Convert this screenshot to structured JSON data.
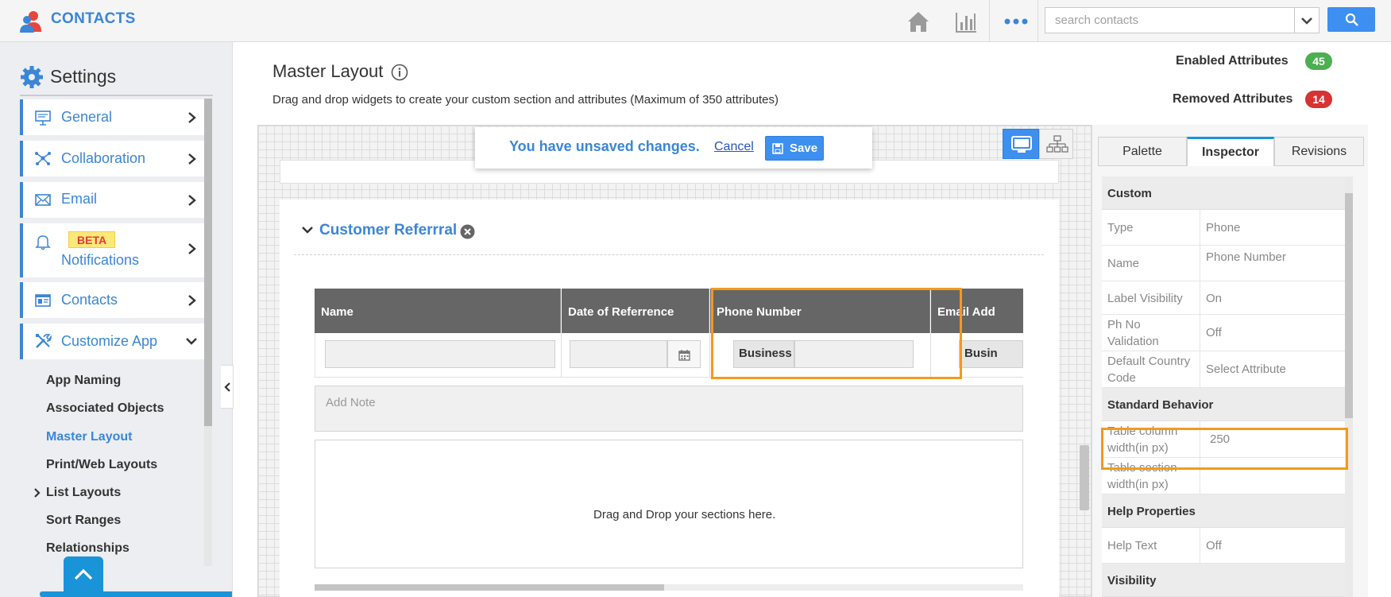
{
  "app": {
    "title": "CONTACTS"
  },
  "topbar": {
    "icons": [
      "home-icon",
      "analytics-icon",
      "more-icon"
    ],
    "search": {
      "placeholder": "search contacts",
      "value": ""
    }
  },
  "sidebar": {
    "title": "Settings",
    "items": [
      {
        "label": "General",
        "icon": "monitor-icon"
      },
      {
        "label": "Collaboration",
        "icon": "collaboration-icon"
      },
      {
        "label": "Email",
        "icon": "envelope-icon"
      },
      {
        "label": "Notifications",
        "icon": "bell-icon",
        "badge": "BETA"
      },
      {
        "label": "Contacts",
        "icon": "contact-card-icon"
      },
      {
        "label": "Customize App",
        "icon": "tools-icon",
        "expanded": true
      }
    ],
    "sub_items": [
      {
        "label": "App Naming"
      },
      {
        "label": "Associated Objects"
      },
      {
        "label": "Master Layout",
        "active": true
      },
      {
        "label": "Print/Web Layouts"
      },
      {
        "label": "List Layouts",
        "has_children": true
      },
      {
        "label": "Sort Ranges"
      },
      {
        "label": "Relationships"
      }
    ]
  },
  "main": {
    "title": "Master Layout",
    "description": "Drag and drop widgets to create your custom section and attributes (Maximum of 350 attributes)",
    "stats": {
      "enabled_label": "Enabled Attributes",
      "enabled_count": "45",
      "removed_label": "Removed Attributes",
      "removed_count": "14"
    },
    "unsaved": {
      "message": "You have unsaved changes.",
      "cancel_label": "Cancel",
      "save_label": "Save"
    },
    "section": {
      "title": "Customer Referrral",
      "columns": [
        "Name",
        "Date of Referrence",
        "Phone Number",
        "Email Add"
      ],
      "phone_prefix": "Business",
      "email_prefix": "Busin",
      "note_placeholder": "Add Note",
      "drop_text": "Drag and Drop your sections here."
    }
  },
  "inspector": {
    "tabs": [
      "Palette",
      "Inspector",
      "Revisions"
    ],
    "active_tab": "Inspector",
    "groups": {
      "custom": "Custom",
      "standard": "Standard Behavior",
      "help": "Help Properties",
      "visibility": "Visibility"
    },
    "custom_rows": [
      {
        "key": "Type",
        "value": "Phone"
      },
      {
        "key": "Name",
        "value": "Phone Number"
      },
      {
        "key": "Label Visibility",
        "value": "On"
      },
      {
        "key": "Ph No Validation",
        "value": "Off"
      },
      {
        "key": "Default Country Code",
        "value": "Select Attribute"
      }
    ],
    "standard_rows": [
      {
        "key": "Table column width(in px)",
        "value": "250"
      },
      {
        "key": "Table section width(in px)",
        "value": ""
      }
    ],
    "help_rows": [
      {
        "key": "Help Text",
        "value": "Off"
      }
    ]
  },
  "colors": {
    "accent": "#3b86d6",
    "enabled_badge": "#4caf50",
    "removed_badge": "#d63333",
    "highlight": "#f39a1d"
  }
}
